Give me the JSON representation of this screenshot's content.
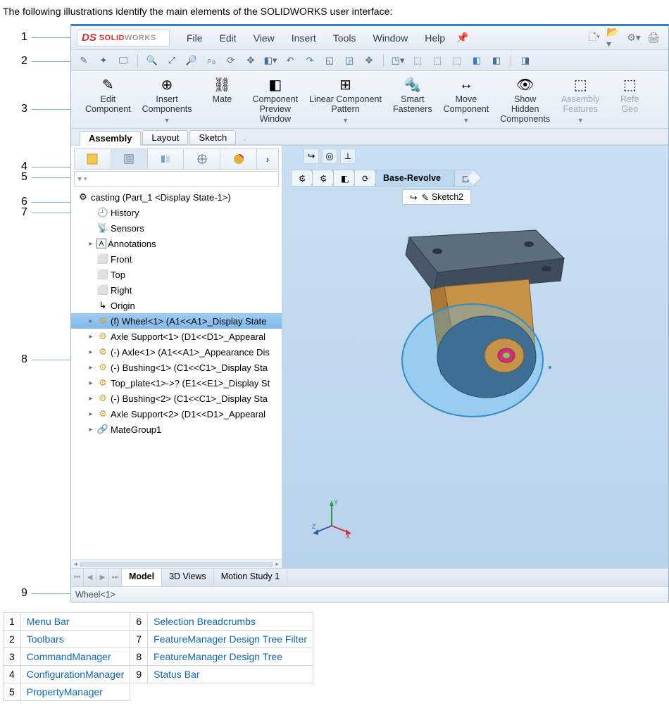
{
  "intro": "The following illustrations identify the main elements of the SOLIDWORKS user interface:",
  "callouts": [
    "1",
    "2",
    "3",
    "4",
    "5",
    "6",
    "7",
    "8",
    "9"
  ],
  "logo": {
    "s": "DS",
    "brand": "SOLID",
    "brand2": "WORKS"
  },
  "menus": [
    "File",
    "Edit",
    "View",
    "Insert",
    "Tools",
    "Window",
    "Help"
  ],
  "cmd": {
    "items": [
      {
        "label": "Edit\nComponent",
        "light": false,
        "drop": false
      },
      {
        "label": "Insert\nComponents",
        "light": false,
        "drop": true
      },
      {
        "label": "Mate",
        "light": false,
        "drop": false
      },
      {
        "label": "Component\nPreview\nWindow",
        "light": false,
        "drop": false
      },
      {
        "label": "Linear Component\nPattern",
        "light": false,
        "drop": true
      },
      {
        "label": "Smart\nFasteners",
        "light": false,
        "drop": false
      },
      {
        "label": "Move\nComponent",
        "light": false,
        "drop": true
      },
      {
        "label": "Show\nHidden\nComponents",
        "light": false,
        "drop": false
      },
      {
        "label": "Assembly\nFeatures",
        "light": true,
        "drop": true
      },
      {
        "label": "Refe\nGeo",
        "light": true,
        "drop": false
      }
    ]
  },
  "cm_tabs": [
    "Assembly",
    "Layout",
    "Sketch"
  ],
  "breadcrumbs": {
    "items": [
      "",
      "",
      "",
      "",
      "Base-Revolve"
    ],
    "sub": "Sketch2"
  },
  "tree": {
    "root": "casting  (Part_1 <Display State-1>)",
    "items": [
      {
        "indent": 1,
        "expand": "",
        "icon": "🕘",
        "text": "History"
      },
      {
        "indent": 1,
        "expand": "",
        "icon": "📡",
        "text": "Sensors"
      },
      {
        "indent": 1,
        "expand": "▸",
        "icon": "A",
        "text": "Annotations"
      },
      {
        "indent": 1,
        "expand": "",
        "icon": "⬜",
        "text": "Front"
      },
      {
        "indent": 1,
        "expand": "",
        "icon": "⬜",
        "text": "Top"
      },
      {
        "indent": 1,
        "expand": "",
        "icon": "⬜",
        "text": "Right"
      },
      {
        "indent": 1,
        "expand": "",
        "icon": "↳",
        "text": "Origin"
      },
      {
        "indent": 1,
        "expand": "▸",
        "icon": "⚙",
        "text": "(f) Wheel<1> (A1<<A1>_Display State",
        "sel": true
      },
      {
        "indent": 1,
        "expand": "▸",
        "icon": "⚙",
        "text": "Axle Support<1> (D1<<D1>_Appearal"
      },
      {
        "indent": 1,
        "expand": "▸",
        "icon": "⚙",
        "text": "(-) Axle<1> (A1<<A1>_Appearance Dis"
      },
      {
        "indent": 1,
        "expand": "▸",
        "icon": "⚙",
        "text": "(-) Bushing<1> (C1<<C1>_Display Sta"
      },
      {
        "indent": 1,
        "expand": "▸",
        "icon": "⚙",
        "text": "Top_plate<1>->? (E1<<E1>_Display St"
      },
      {
        "indent": 1,
        "expand": "▸",
        "icon": "⚙",
        "text": "(-) Bushing<2> (C1<<C1>_Display Sta"
      },
      {
        "indent": 1,
        "expand": "▸",
        "icon": "⚙",
        "text": "Axle Support<2> (D1<<D1>_Appearal"
      },
      {
        "indent": 1,
        "expand": "▸",
        "icon": "🔗",
        "text": "MateGroup1"
      }
    ]
  },
  "bottom_tabs": [
    "Model",
    "3D Views",
    "Motion Study 1"
  ],
  "status": "Wheel<1>",
  "legend": [
    {
      "n": "1",
      "label": "Menu Bar"
    },
    {
      "n": "2",
      "label": "Toolbars"
    },
    {
      "n": "3",
      "label": "CommandManager"
    },
    {
      "n": "4",
      "label": "ConfigurationManager"
    },
    {
      "n": "5",
      "label": "PropertyManager"
    },
    {
      "n": "6",
      "label": "Selection Breadcrumbs"
    },
    {
      "n": "7",
      "label": "FeatureManager Design Tree Filter"
    },
    {
      "n": "8",
      "label": "FeatureManager Design Tree"
    },
    {
      "n": "9",
      "label": "Status Bar"
    }
  ]
}
